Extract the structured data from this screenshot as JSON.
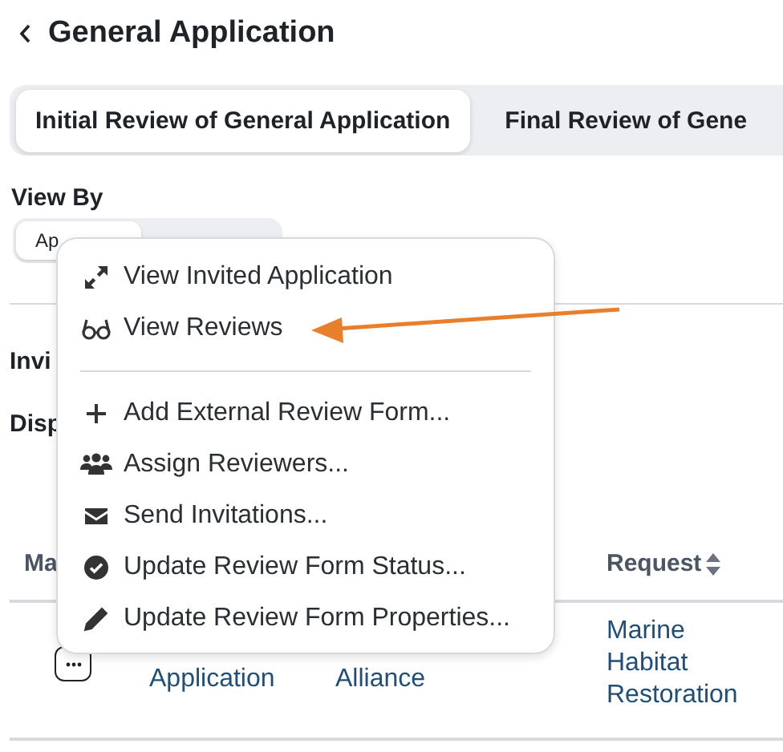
{
  "header": {
    "title": "General Application"
  },
  "tabs": [
    {
      "label": "Initial Review of General Application",
      "selected": true
    },
    {
      "label": "Final Review of Gene",
      "selected": false
    }
  ],
  "view_by": {
    "label": "View By",
    "options": [
      {
        "label": "Ap",
        "selected": true
      }
    ]
  },
  "fields": [
    {
      "label": "Invi"
    },
    {
      "label": "Disp"
    }
  ],
  "table": {
    "columns": [
      {
        "label": "Ma",
        "sortable": false
      },
      {},
      {},
      {
        "label": "Request",
        "sortable": true
      }
    ],
    "rows": [
      {
        "cells": [
          "",
          "Application",
          "Alliance",
          "Marine Habitat Restoration"
        ]
      }
    ]
  },
  "menu": {
    "items": [
      {
        "kind": "item",
        "label": "View Invited Application"
      },
      {
        "kind": "item",
        "label": "View Reviews"
      },
      {
        "kind": "divider"
      },
      {
        "kind": "item",
        "label": "Add External Review Form..."
      },
      {
        "kind": "item",
        "label": "Assign Reviewers..."
      },
      {
        "kind": "item",
        "label": "Send Invitations..."
      },
      {
        "kind": "item",
        "label": "Update Review Form Status..."
      },
      {
        "kind": "item",
        "label": "Update Review Form Properties..."
      }
    ]
  }
}
